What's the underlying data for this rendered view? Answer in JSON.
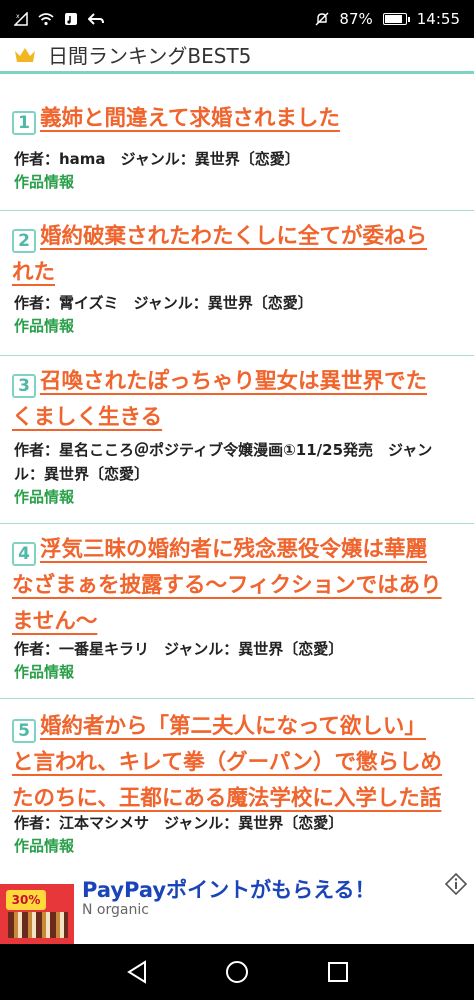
{
  "status_bar": {
    "battery": "87%",
    "battery_level": 0.87,
    "time": "14:55",
    "icons": [
      "signal-icon",
      "wifi-icon",
      "music-icon",
      "back-arrow-icon",
      "mute-icon",
      "battery-icon"
    ]
  },
  "header": {
    "icon": "crown-icon",
    "title": "日間ランキングBEST5"
  },
  "colors": {
    "title": "#f0642d",
    "accent": "#7fd3c2",
    "info_link": "#2aa04a",
    "ad_title": "#1a44b8"
  },
  "ranking": [
    {
      "rank": "1",
      "title_lines": [
        "義姉と間違えて求婚されました"
      ],
      "meta_lines": [
        "作者：hama　ジャンル：異世界〔恋愛〕"
      ],
      "info": "作品情報"
    },
    {
      "rank": "2",
      "title_lines": [
        "婚約破棄されたわたくしに全てが委ねら",
        "れた"
      ],
      "meta_lines": [
        "作者：霄イズミ　ジャンル：異世界〔恋愛〕"
      ],
      "info": "作品情報"
    },
    {
      "rank": "3",
      "title_lines": [
        "召喚されたぽっちゃり聖女は異世界でた",
        "くましく生きる"
      ],
      "meta_lines": [
        "作者：星名こころ＠ポジティブ令嬢漫画①11/25発売　ジャン",
        "ル：異世界〔恋愛〕"
      ],
      "info": "作品情報"
    },
    {
      "rank": "4",
      "title_lines": [
        "浮気三昧の婚約者に残念悪役令嬢は華麗",
        "なざまぁを披露する〜フィクションではあり",
        "ません〜"
      ],
      "meta_lines": [
        "作者：一番星キラリ　ジャンル：異世界〔恋愛〕"
      ],
      "info": "作品情報"
    },
    {
      "rank": "5",
      "title_lines": [
        "婚約者から「第二夫人になって欲しい」",
        "と言われ、キレて拳（グーパン）で懲らしめ",
        "たのちに、王都にある魔法学校に入学した話"
      ],
      "meta_lines": [
        "作者：江本マシメサ　ジャンル：異世界〔恋愛〕"
      ],
      "info": "作品情報"
    }
  ],
  "ad": {
    "title": "PayPayポイントがもらえる！",
    "sponsor": "N organic",
    "thumb_text": "30%",
    "info_icon": "ad-info-icon"
  },
  "nav_bar": {
    "buttons": [
      "back-triangle-icon",
      "home-circle-icon",
      "recents-square-icon"
    ]
  }
}
